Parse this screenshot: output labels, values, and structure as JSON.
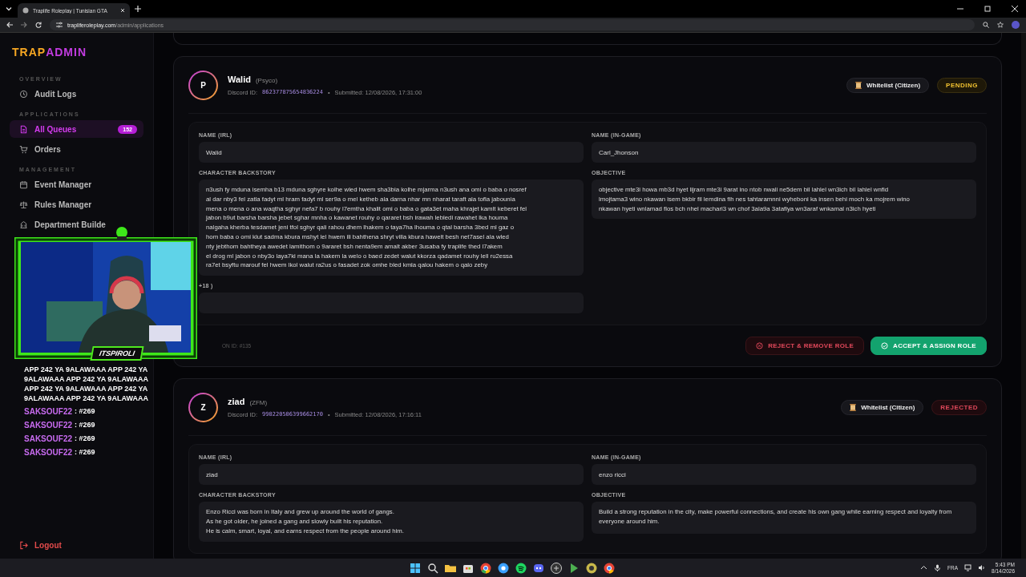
{
  "browser": {
    "tab_title": "Traplife Roleplay | Tunisian GTA",
    "url_domain": "trapliferoleplay.com",
    "url_path": "/admin/applications"
  },
  "sidebar": {
    "logo": [
      "TRAP",
      "ADMIN"
    ],
    "sections": [
      {
        "title": "OVERVIEW",
        "items": [
          {
            "label": "Audit Logs",
            "selected": false
          }
        ]
      },
      {
        "title": "APPLICATIONS",
        "items": [
          {
            "label": "All Queues",
            "selected": true,
            "badge": "152"
          },
          {
            "label": "Orders",
            "selected": false
          }
        ]
      },
      {
        "title": "MANAGEMENT",
        "items": [
          {
            "label": "Event Manager",
            "selected": false
          },
          {
            "label": "Rules Manager",
            "selected": false
          },
          {
            "label": "Department Builde",
            "selected": false
          }
        ]
      }
    ],
    "logout": "Logout"
  },
  "applications": [
    {
      "initial": "P",
      "name": "Walid",
      "nickname": "(Psyco)",
      "discord_label": "Discord ID:",
      "discord_id": "862377875654836224",
      "separator": "•",
      "submitted": "Submitted: 12/08/2026, 17:31:00",
      "type": "Whitelist (Citizen)",
      "status": {
        "label": "PENDING",
        "kind": "pending"
      },
      "fields": [
        {
          "label": "NAME (IRL)",
          "value": "Walid"
        },
        {
          "label": "NAME (IN-GAME)",
          "value": "Carl_Jhonson"
        },
        {
          "label": "CHARACTER BACKSTORY",
          "value": "n3ush fy mduna isemha b13 mduna sghyre kolhe wled hwem sha3bia kolhe mjarma n3ush ana omi o baba o nosref\nal dar nby3 fel zatla fadyt ml hram fadyt ml ser9a o mel ketheb ala darna nhar mn nharat taraft ala tofla jabounia\nmena o mena o ana waqtha sghyr nefa7 b rouhy l7emtha khalit omi o baba o gata3et maha khrajet kamlt keberet fel\njabon b9ut barsha barsha jebet sghar mnha o kawanet rouhy o qararet bsh irawah lebledi rawahet lka houma\nnalgaha kherba tesdamet jeni tfol sghyr qali rahou dhem lhakem o taya7ha lhouma o qtal barsha 3bed ml gaz o\nhom baba o omi klut sadma kbura mshyt lel hwem ili bahthena shryt villa kbura hawelt besh net7asel ala wled\nnty jebthom bahtheya awedet lamithom o 9araret bsh nenta9em amalt akber 3usaba fy traplife thed l7akem\nel drog ml jabon o nby3o laya7ki mana la hakem la welo o baed zedet walut kkorza qadamet rouhy lell ru2essa\nra7et bsyftu marouf fel hwem lkol walut ra2us o fasadet zok omhe bled kmla qalou hakem o qalo zeby"
        },
        {
          "label": "OBJECTIVE",
          "value": "objective mte3i howa mb3d hyet lijram mte3i 9arat ino ntob nwali ne5dem bil lahlel wn3ich bil lahlel wnfid\nlmojtama3 wino nkawan isem bkbir fil lemdina fih nes tahtaramnni wyheboni ka insen behi moch ka mojrem wino\nnkawan hyeti wnlamad flos bch nhel machari3 wn chof 3ala9a 3atafiya wn3araf wnkamal n3ich hyeti"
        },
        {
          "label": "+18 )"
        }
      ],
      "footer_id": "ON ID: #135",
      "actions": [
        {
          "label": "REJECT & REMOVE ROLE",
          "kind": "reject"
        },
        {
          "label": "ACCEPT & ASSIGN ROLE",
          "kind": "accept"
        }
      ]
    },
    {
      "initial": "Z",
      "name": "ziad",
      "nickname": "(ZFM)",
      "discord_label": "Discord ID:",
      "discord_id": "990220506399662170",
      "separator": "•",
      "submitted": "Submitted: 12/08/2026, 17:16:11",
      "type": "Whitelist (Citizen)",
      "status": {
        "label": "REJECTED",
        "kind": "rejected"
      },
      "fields": [
        {
          "label": "NAME (IRL)",
          "value": "ziad"
        },
        {
          "label": "NAME (IN-GAME)",
          "value": "enzo ricci"
        },
        {
          "label": "CHARACTER BACKSTORY",
          "value": "Enzo Ricci was born in Italy and grew up around the world of gangs.\nAs he got older, he joined a gang and slowly built his reputation.\nHe is calm, smart, loyal, and earns respect from the people around him."
        },
        {
          "label": "OBJECTIVE",
          "value": "Build a strong reputation in the city, make powerful connections, and create his own gang while earning respect and loyalty from everyone around him."
        }
      ]
    }
  ],
  "stream_overlay": {
    "kind": "picture",
    "streamer": "ITSPIROLI",
    "chat": [
      {
        "text": "APP 242 YA 9ALAWAAA APP 242 YA"
      },
      {
        "text": "9ALAWAAA APP 242 YA 9ALAWAAA"
      },
      {
        "text": "APP 242 YA 9ALAWAAA APP 242 YA"
      },
      {
        "text": "9ALAWAAA APP 242 YA 9ALAWAAA"
      },
      {
        "user": "SAKSOUF22",
        "text": ": #269"
      },
      {
        "user": "SAKSOUF22",
        "text": ": #269"
      },
      {
        "user": "SAKSOUF22",
        "text": ": #269"
      },
      {
        "user": "SAKSOUF22",
        "text": ": #269"
      }
    ]
  },
  "taskbar": {
    "language": "FRA",
    "time": "5:43 PM",
    "date": "8/14/2026"
  }
}
